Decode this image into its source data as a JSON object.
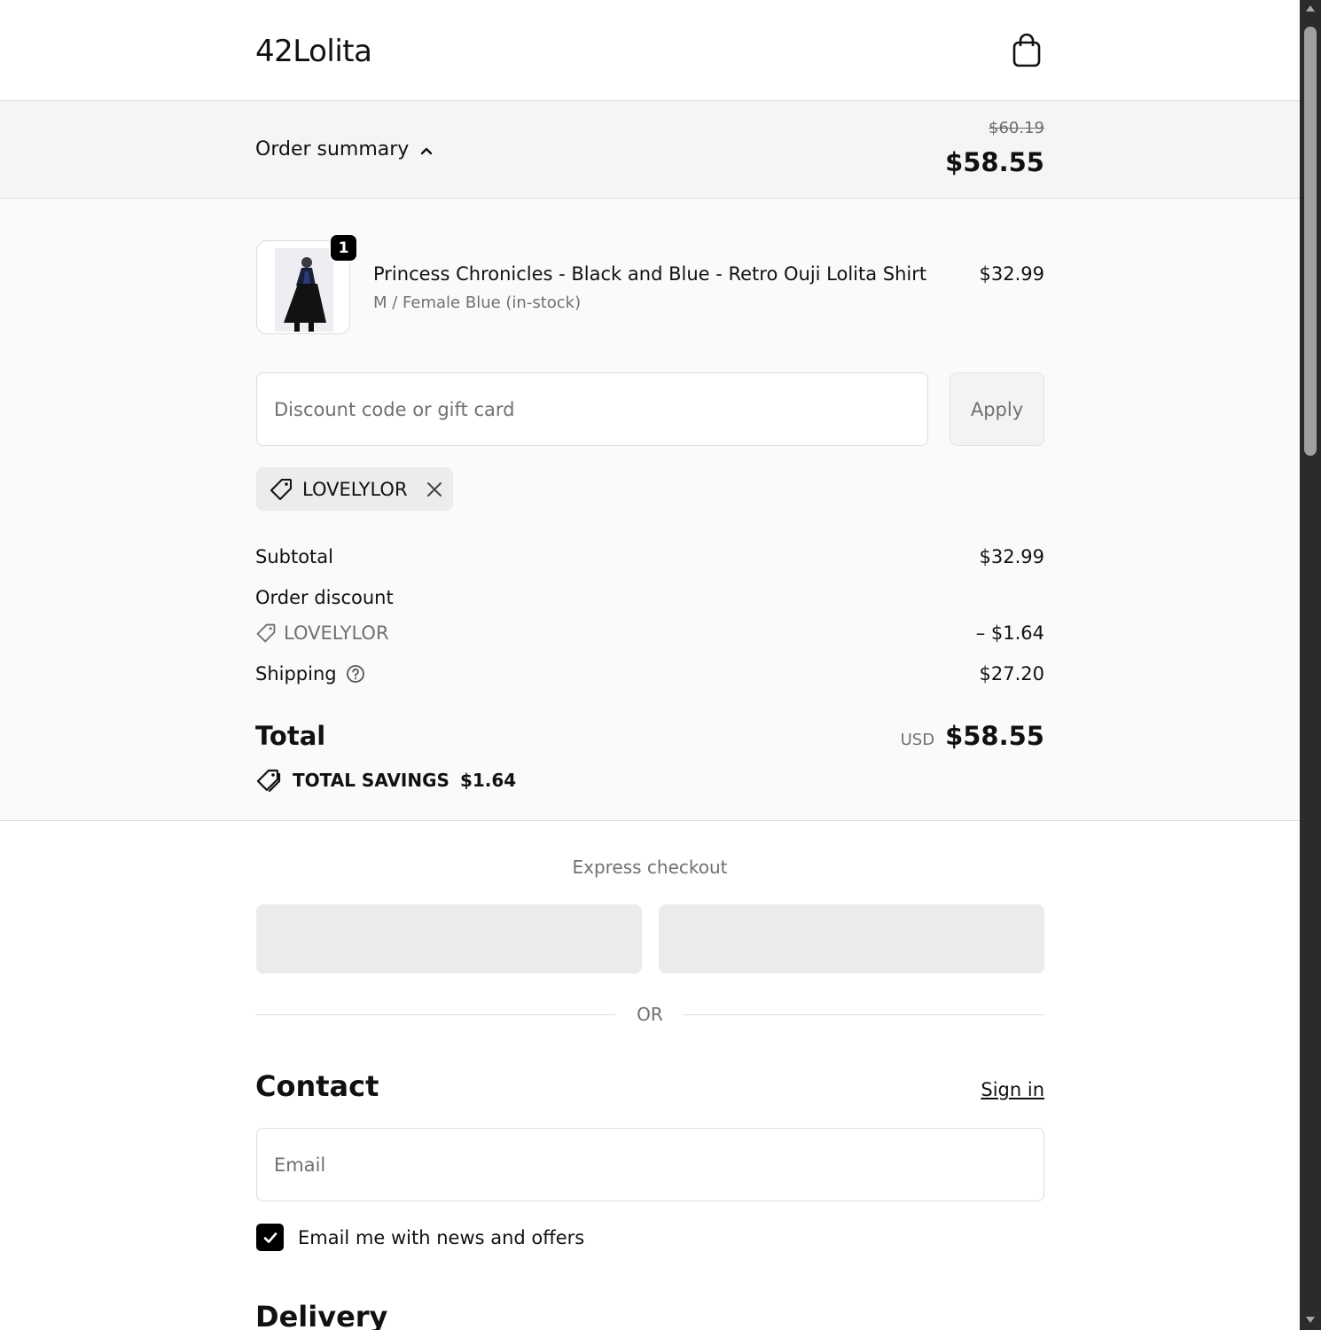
{
  "header": {
    "logo": "42Lolita",
    "cart_icon": "shopping-bag-icon"
  },
  "summary_bar": {
    "toggle_label": "Order summary",
    "toggle_icon": "chevron-up-icon",
    "original_price": "$60.19",
    "total_price": "$58.55"
  },
  "line_item": {
    "quantity": "1",
    "name": "Princess Chronicles - Black and Blue - Retro Ouji Lolita Shirt",
    "variant": "M / Female Blue (in-stock)",
    "price": "$32.99"
  },
  "discount": {
    "placeholder": "Discount code or gift card",
    "apply_label": "Apply",
    "applied_code": "LOVELYLOR",
    "tag_icon": "tag-icon",
    "remove_icon": "close-icon"
  },
  "totals": {
    "subtotal_label": "Subtotal",
    "subtotal_value": "$32.99",
    "order_discount_label": "Order discount",
    "discount_code": "LOVELYLOR",
    "discount_value": "– $1.64",
    "shipping_label": "Shipping",
    "shipping_value": "$27.20",
    "total_label": "Total",
    "currency": "USD",
    "total_value": "$58.55",
    "savings_label": "TOTAL SAVINGS",
    "savings_value": "$1.64"
  },
  "express": {
    "title": "Express checkout",
    "divider_text": "OR"
  },
  "contact": {
    "heading": "Contact",
    "signin_label": "Sign in",
    "email_placeholder": "Email",
    "newsletter_label": "Email me with news and offers",
    "newsletter_checked": true
  },
  "delivery": {
    "heading": "Delivery"
  },
  "colors": {
    "accent": "#000000",
    "summary_bg": "#f5f5f5",
    "panel_bg": "#fafafa",
    "muted_text": "#707070"
  }
}
